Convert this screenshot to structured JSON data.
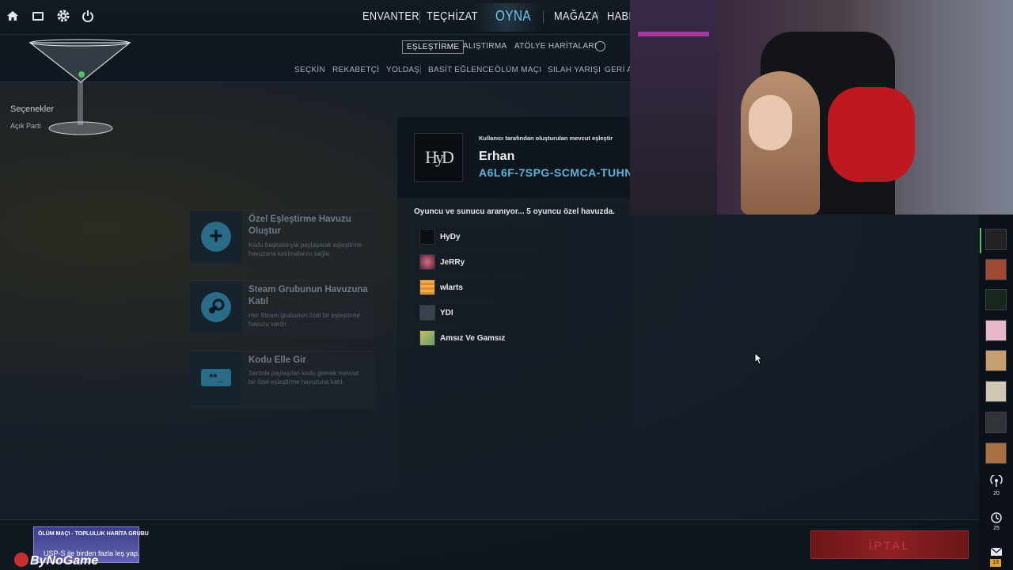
{
  "topnav": {
    "items": [
      "ENVANTER",
      "TEÇHİZAT",
      "OYNA",
      "MAĞAZA",
      "HABE"
    ]
  },
  "subtabs": [
    "EŞLEŞTİRME",
    "ALIŞTIRMA",
    "ATÖLYE HARİTALARI"
  ],
  "modes": [
    "SEÇKİN",
    "REKABETÇİ",
    "YOLDAŞ",
    "BASİT EĞLENCE",
    "ÖLÜM MAÇI",
    "SILAH YARIŞI",
    "GERİ AL"
  ],
  "sidebar": {
    "options_label": "Seçenekler",
    "party_label": "Açık Parti"
  },
  "options": [
    {
      "title": "Özel Eşleştirme Havuzu Oluştur",
      "desc": "Kodu başkalarıyla paylaşarak eşleştirme havuzuna katılmalarını sağla.",
      "icon": "plus-icon"
    },
    {
      "title": "Steam Grubunun Havuzuna Katıl",
      "desc": "Her Steam grubunun özel bir eşleştirme havuzu vardır.",
      "icon": "steam-icon"
    },
    {
      "title": "Kodu Elle Gir",
      "desc": "Seninle paylaşılan kodu girerek mevcut bir özel eşleştirme havuzuna katıl.",
      "icon": "keyboard-icon",
      "icon_text": "**_"
    }
  ],
  "pool": {
    "header": "Kullanıcı tarafından oluşturulan mevcut eşleştir",
    "logo_text": "HyD",
    "owner": "Erhan",
    "code": "A6L6F-7SPG-SCMCA-TUHN",
    "status": "Oyuncu ve sunucu aranıyor... 5 oyuncu özel havuzda.",
    "players": [
      "HyDy",
      "JeRRy",
      "wlarts",
      "YDI",
      "Amsız Ve Gamsız"
    ]
  },
  "friends": {
    "broadcast_count": "20",
    "history_count": "25",
    "mail_count": "13"
  },
  "cancel_label": "İPTAL",
  "banner": {
    "title": "ÖLÜM MAÇI - TOPLULUK HARİTA GRUBU",
    "text": "USP-S ile birden fazla leş yap.",
    "brand": "ByNoGame"
  },
  "colors": {
    "accent": "#6fc6e8",
    "cancel": "#8e2125"
  }
}
